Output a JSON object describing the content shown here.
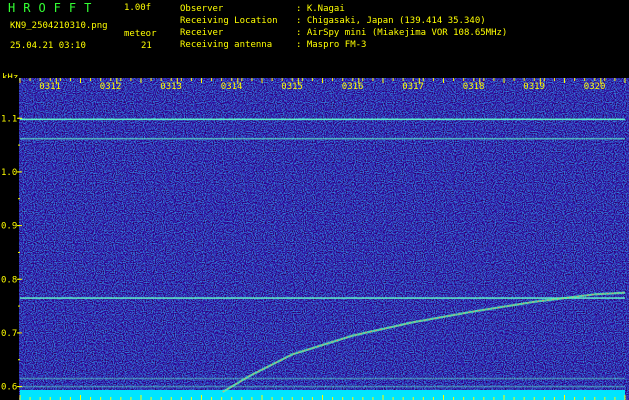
{
  "header": {
    "logo": "HROFFT",
    "version": "1.00f",
    "filename": "KN9_2504210310.png",
    "meteor_label": "meteor",
    "datetime": "25.04.21 03:10",
    "meteor_count": "21",
    "info": [
      {
        "label": "Observer",
        "value": "K.Nagai"
      },
      {
        "label": "Receiving Location",
        "value": "Chigasaki, Japan (139.414 35.340)"
      },
      {
        "label": "Receiver",
        "value": "AirSpy mini (Miakejima VOR 108.65MHz)"
      },
      {
        "label": "Receiving antenna",
        "value": "Maspro FM-3"
      }
    ]
  },
  "colors": {
    "background": "#000000",
    "plot_bg": "#0a0d7a",
    "text": "#ffff00",
    "logo": "#33ff33",
    "base_band": "#00e5ff"
  },
  "chart_data": {
    "type": "heatmap",
    "yunit": "kHz",
    "ylim": [
      0.575,
      1.175
    ],
    "yticks": [
      "1.1",
      "1.0",
      "0.9",
      "0.8",
      "0.7",
      "0.6"
    ],
    "yvalues": [
      1.1,
      1.0,
      0.9,
      0.8,
      0.7,
      0.6
    ],
    "xticks": [
      "0311",
      "0312",
      "0313",
      "0314",
      "0315",
      "0316",
      "0317",
      "0318",
      "0319",
      "0320"
    ],
    "xlim": [
      0,
      10
    ],
    "lines": [
      {
        "freq": 1.098,
        "intensity": 0.9
      },
      {
        "freq": 1.062,
        "intensity": 0.6
      },
      {
        "freq": 0.765,
        "intensity": 0.85
      },
      {
        "freq": 0.615,
        "intensity": 0.4
      },
      {
        "freq": 0.6,
        "intensity": 0.4
      }
    ],
    "meteor_trail": [
      {
        "x": 3.35,
        "f": 0.59
      },
      {
        "x": 3.8,
        "f": 0.62
      },
      {
        "x": 4.5,
        "f": 0.66
      },
      {
        "x": 5.5,
        "f": 0.695
      },
      {
        "x": 6.5,
        "f": 0.72
      },
      {
        "x": 7.5,
        "f": 0.74
      },
      {
        "x": 8.5,
        "f": 0.758
      },
      {
        "x": 9.5,
        "f": 0.772
      },
      {
        "x": 10.0,
        "f": 0.775
      }
    ]
  }
}
